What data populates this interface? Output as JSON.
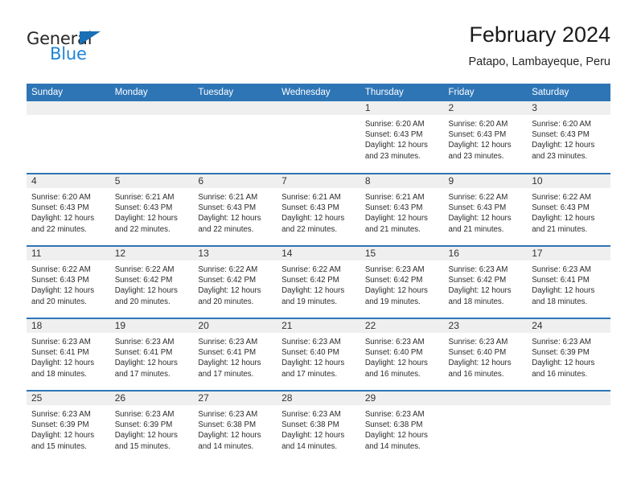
{
  "brand": {
    "word_one": "General",
    "word_two": "Blue",
    "triangle_icon": "triangle-icon",
    "color_dark": "#262626",
    "color_blue": "#1f84d6"
  },
  "header": {
    "title": "February 2024",
    "subtitle": "Patapo, Lambayeque, Peru"
  },
  "theme": {
    "header_blue": "#2e75b6",
    "daynum_band": "#efefef",
    "text": "#2b2b2b"
  },
  "calendar": {
    "weekday_headers": [
      "Sunday",
      "Monday",
      "Tuesday",
      "Wednesday",
      "Thursday",
      "Friday",
      "Saturday"
    ],
    "weeks": [
      [
        {
          "day": "",
          "empty": true,
          "sunrise": "",
          "sunset": "",
          "daylight_line1": "",
          "daylight_line2": ""
        },
        {
          "day": "",
          "empty": true,
          "sunrise": "",
          "sunset": "",
          "daylight_line1": "",
          "daylight_line2": ""
        },
        {
          "day": "",
          "empty": true,
          "sunrise": "",
          "sunset": "",
          "daylight_line1": "",
          "daylight_line2": ""
        },
        {
          "day": "",
          "empty": true,
          "sunrise": "",
          "sunset": "",
          "daylight_line1": "",
          "daylight_line2": ""
        },
        {
          "day": "1",
          "empty": false,
          "sunrise": "Sunrise: 6:20 AM",
          "sunset": "Sunset: 6:43 PM",
          "daylight_line1": "Daylight: 12 hours",
          "daylight_line2": "and 23 minutes."
        },
        {
          "day": "2",
          "empty": false,
          "sunrise": "Sunrise: 6:20 AM",
          "sunset": "Sunset: 6:43 PM",
          "daylight_line1": "Daylight: 12 hours",
          "daylight_line2": "and 23 minutes."
        },
        {
          "day": "3",
          "empty": false,
          "sunrise": "Sunrise: 6:20 AM",
          "sunset": "Sunset: 6:43 PM",
          "daylight_line1": "Daylight: 12 hours",
          "daylight_line2": "and 23 minutes."
        }
      ],
      [
        {
          "day": "4",
          "empty": false,
          "sunrise": "Sunrise: 6:20 AM",
          "sunset": "Sunset: 6:43 PM",
          "daylight_line1": "Daylight: 12 hours",
          "daylight_line2": "and 22 minutes."
        },
        {
          "day": "5",
          "empty": false,
          "sunrise": "Sunrise: 6:21 AM",
          "sunset": "Sunset: 6:43 PM",
          "daylight_line1": "Daylight: 12 hours",
          "daylight_line2": "and 22 minutes."
        },
        {
          "day": "6",
          "empty": false,
          "sunrise": "Sunrise: 6:21 AM",
          "sunset": "Sunset: 6:43 PM",
          "daylight_line1": "Daylight: 12 hours",
          "daylight_line2": "and 22 minutes."
        },
        {
          "day": "7",
          "empty": false,
          "sunrise": "Sunrise: 6:21 AM",
          "sunset": "Sunset: 6:43 PM",
          "daylight_line1": "Daylight: 12 hours",
          "daylight_line2": "and 22 minutes."
        },
        {
          "day": "8",
          "empty": false,
          "sunrise": "Sunrise: 6:21 AM",
          "sunset": "Sunset: 6:43 PM",
          "daylight_line1": "Daylight: 12 hours",
          "daylight_line2": "and 21 minutes."
        },
        {
          "day": "9",
          "empty": false,
          "sunrise": "Sunrise: 6:22 AM",
          "sunset": "Sunset: 6:43 PM",
          "daylight_line1": "Daylight: 12 hours",
          "daylight_line2": "and 21 minutes."
        },
        {
          "day": "10",
          "empty": false,
          "sunrise": "Sunrise: 6:22 AM",
          "sunset": "Sunset: 6:43 PM",
          "daylight_line1": "Daylight: 12 hours",
          "daylight_line2": "and 21 minutes."
        }
      ],
      [
        {
          "day": "11",
          "empty": false,
          "sunrise": "Sunrise: 6:22 AM",
          "sunset": "Sunset: 6:43 PM",
          "daylight_line1": "Daylight: 12 hours",
          "daylight_line2": "and 20 minutes."
        },
        {
          "day": "12",
          "empty": false,
          "sunrise": "Sunrise: 6:22 AM",
          "sunset": "Sunset: 6:42 PM",
          "daylight_line1": "Daylight: 12 hours",
          "daylight_line2": "and 20 minutes."
        },
        {
          "day": "13",
          "empty": false,
          "sunrise": "Sunrise: 6:22 AM",
          "sunset": "Sunset: 6:42 PM",
          "daylight_line1": "Daylight: 12 hours",
          "daylight_line2": "and 20 minutes."
        },
        {
          "day": "14",
          "empty": false,
          "sunrise": "Sunrise: 6:22 AM",
          "sunset": "Sunset: 6:42 PM",
          "daylight_line1": "Daylight: 12 hours",
          "daylight_line2": "and 19 minutes."
        },
        {
          "day": "15",
          "empty": false,
          "sunrise": "Sunrise: 6:23 AM",
          "sunset": "Sunset: 6:42 PM",
          "daylight_line1": "Daylight: 12 hours",
          "daylight_line2": "and 19 minutes."
        },
        {
          "day": "16",
          "empty": false,
          "sunrise": "Sunrise: 6:23 AM",
          "sunset": "Sunset: 6:42 PM",
          "daylight_line1": "Daylight: 12 hours",
          "daylight_line2": "and 18 minutes."
        },
        {
          "day": "17",
          "empty": false,
          "sunrise": "Sunrise: 6:23 AM",
          "sunset": "Sunset: 6:41 PM",
          "daylight_line1": "Daylight: 12 hours",
          "daylight_line2": "and 18 minutes."
        }
      ],
      [
        {
          "day": "18",
          "empty": false,
          "sunrise": "Sunrise: 6:23 AM",
          "sunset": "Sunset: 6:41 PM",
          "daylight_line1": "Daylight: 12 hours",
          "daylight_line2": "and 18 minutes."
        },
        {
          "day": "19",
          "empty": false,
          "sunrise": "Sunrise: 6:23 AM",
          "sunset": "Sunset: 6:41 PM",
          "daylight_line1": "Daylight: 12 hours",
          "daylight_line2": "and 17 minutes."
        },
        {
          "day": "20",
          "empty": false,
          "sunrise": "Sunrise: 6:23 AM",
          "sunset": "Sunset: 6:41 PM",
          "daylight_line1": "Daylight: 12 hours",
          "daylight_line2": "and 17 minutes."
        },
        {
          "day": "21",
          "empty": false,
          "sunrise": "Sunrise: 6:23 AM",
          "sunset": "Sunset: 6:40 PM",
          "daylight_line1": "Daylight: 12 hours",
          "daylight_line2": "and 17 minutes."
        },
        {
          "day": "22",
          "empty": false,
          "sunrise": "Sunrise: 6:23 AM",
          "sunset": "Sunset: 6:40 PM",
          "daylight_line1": "Daylight: 12 hours",
          "daylight_line2": "and 16 minutes."
        },
        {
          "day": "23",
          "empty": false,
          "sunrise": "Sunrise: 6:23 AM",
          "sunset": "Sunset: 6:40 PM",
          "daylight_line1": "Daylight: 12 hours",
          "daylight_line2": "and 16 minutes."
        },
        {
          "day": "24",
          "empty": false,
          "sunrise": "Sunrise: 6:23 AM",
          "sunset": "Sunset: 6:39 PM",
          "daylight_line1": "Daylight: 12 hours",
          "daylight_line2": "and 16 minutes."
        }
      ],
      [
        {
          "day": "25",
          "empty": false,
          "sunrise": "Sunrise: 6:23 AM",
          "sunset": "Sunset: 6:39 PM",
          "daylight_line1": "Daylight: 12 hours",
          "daylight_line2": "and 15 minutes."
        },
        {
          "day": "26",
          "empty": false,
          "sunrise": "Sunrise: 6:23 AM",
          "sunset": "Sunset: 6:39 PM",
          "daylight_line1": "Daylight: 12 hours",
          "daylight_line2": "and 15 minutes."
        },
        {
          "day": "27",
          "empty": false,
          "sunrise": "Sunrise: 6:23 AM",
          "sunset": "Sunset: 6:38 PM",
          "daylight_line1": "Daylight: 12 hours",
          "daylight_line2": "and 14 minutes."
        },
        {
          "day": "28",
          "empty": false,
          "sunrise": "Sunrise: 6:23 AM",
          "sunset": "Sunset: 6:38 PM",
          "daylight_line1": "Daylight: 12 hours",
          "daylight_line2": "and 14 minutes."
        },
        {
          "day": "29",
          "empty": false,
          "sunrise": "Sunrise: 6:23 AM",
          "sunset": "Sunset: 6:38 PM",
          "daylight_line1": "Daylight: 12 hours",
          "daylight_line2": "and 14 minutes."
        },
        {
          "day": "",
          "empty": true,
          "sunrise": "",
          "sunset": "",
          "daylight_line1": "",
          "daylight_line2": ""
        },
        {
          "day": "",
          "empty": true,
          "sunrise": "",
          "sunset": "",
          "daylight_line1": "",
          "daylight_line2": ""
        }
      ]
    ]
  }
}
